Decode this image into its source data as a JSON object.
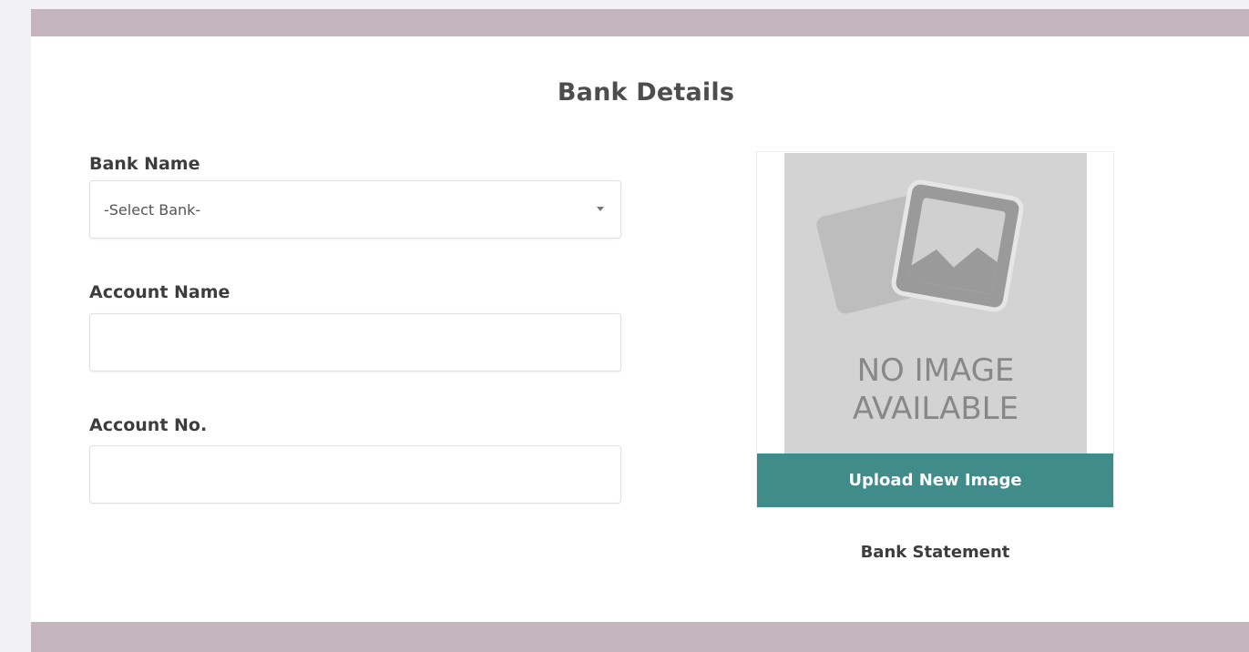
{
  "bank_details": {
    "title": "Bank Details",
    "bank_name": {
      "label": "Bank Name",
      "selected": "-Select Bank-"
    },
    "account_name": {
      "label": "Account Name",
      "value": ""
    },
    "account_no": {
      "label": "Account No.",
      "value": ""
    },
    "image": {
      "placeholder_line1": "NO IMAGE",
      "placeholder_line2": "AVAILABLE",
      "placeholder_icon": "picture-icon",
      "upload_label": "Upload New Image",
      "caption": "Bank Statement"
    }
  },
  "colors": {
    "header_bar": "#c4b5bd",
    "upload_button": "#3f8c8a",
    "placeholder_bg": "#d3d3d3"
  }
}
